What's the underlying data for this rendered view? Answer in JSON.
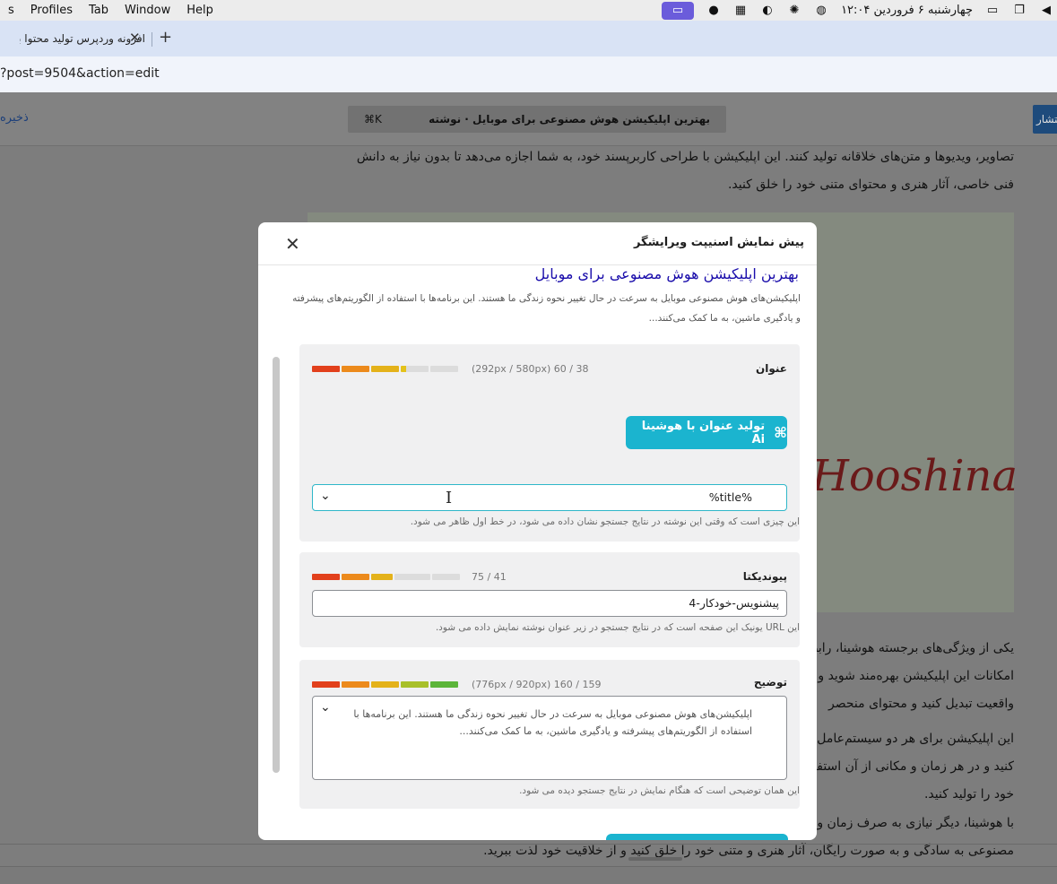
{
  "menubar": {
    "items": [
      "s",
      "Profiles",
      "Tab",
      "Window",
      "Help"
    ],
    "datetime": "چهارشنبه ۶ فروردین ۱۲:۰۴"
  },
  "browser": {
    "tab_title": "افزونه وردپرس تولید محتوا با هوش مصنوعی",
    "url": "?post=9504&action=edit"
  },
  "editor": {
    "save_label": "ذخیره",
    "doc_title": "بهترین اپلیکیشن هوش مصنوعی برای موبایل · نوشته",
    "shortcut": "⌘K",
    "publish_label": "انتشار",
    "para1_line1": "تصاویر، ویدیوها و متن‌های خلاقانه تولید کنند. این اپلیکیشن با طراحی کاربرپسند خود، به شما اجازه می‌دهد تا بدون نیاز به دانش",
    "para1_line2": "فنی خاصی، آثار هنری و محتوای متنی خود را خلق کنید.",
    "hero_word": "Hooshina",
    "para2_line1": "یکی از ویژگی‌های برجسته هوشینا، رابط",
    "para2_line2": "امکانات این اپلیکیشن بهره‌مند شوید و",
    "para2_line3": "واقعیت تبدیل کنید و محتوای منحصر",
    "para3_line1": "این اپلیکیشن برای هر دو سیستم‌عامل",
    "para3_line2": "کنید و در هر زمان و مکانی از آن استفاده",
    "para3_line3": "خود را تولید کنید.",
    "para4_line1": "با هوشینا، دیگر نیازی به صرف زمان و",
    "para4_line2": "مصنوعی به سادگی و به صورت رایگان، آثار هنری و متنی خود را خلق کنید و از خلاقیت خود لذت ببرید."
  },
  "modal": {
    "title": "پیش نمایش اسنیپت ویرایشگر",
    "snippet_title": "بهترین اپلیکیشن هوش مصنوعی برای موبایل",
    "snippet_desc_line1": "اپلیکیشن‌های هوش مصنوعی موبایل به سرعت در حال تغییر نحوه زندگی ما هستند. این برنامه‌ها با استفاده از الگوریتم‌های پیشرفته",
    "snippet_desc_line2": "و یادگیری ماشین، به ما کمک می‌کنند...",
    "title_field": {
      "label": "عنوان",
      "meter_text": "(292px / 580px) 60 / 38",
      "progress": 0.5,
      "ai_button": "تولید عنوان با هوشینا Ai",
      "value": "%title%",
      "help": "این چیزی است که وقتی این نوشته در نتایج جستجو نشان داده می شود، در خط اول ظاهر می شود."
    },
    "slug_field": {
      "label": "پیوندیکتا",
      "meter_text": "75 / 41",
      "progress": 0.55,
      "value": "پیشنویس-خودکار-4",
      "help": "این URL یونیک این صفحه است که در نتایج جستجو در زیر عنوان نوشته نمایش داده می شود."
    },
    "desc_field": {
      "label": "توضیح",
      "meter_text": "(776px / 920px) 160 / 159",
      "progress": 0.99,
      "value_line1": "اپلیکیشن‌های هوش مصنوعی موبایل به سرعت در حال تغییر نحوه زندگی ما هستند. این برنامه‌ها با",
      "value_line2": "استفاده از الگوریتم‌های پیشرفته و یادگیری ماشین، به ما کمک می‌کنند...",
      "help": "این همان توضیحی است که هنگام نمایش در نتایج جستجو دیده می شود."
    }
  },
  "colors": {
    "accent": "#1bb4cf",
    "link_blue": "#1a0dab",
    "meter_red": "#e2401c",
    "meter_orange": "#f0a020",
    "meter_yellow": "#e4c21a",
    "meter_green": "#5cb53a"
  }
}
